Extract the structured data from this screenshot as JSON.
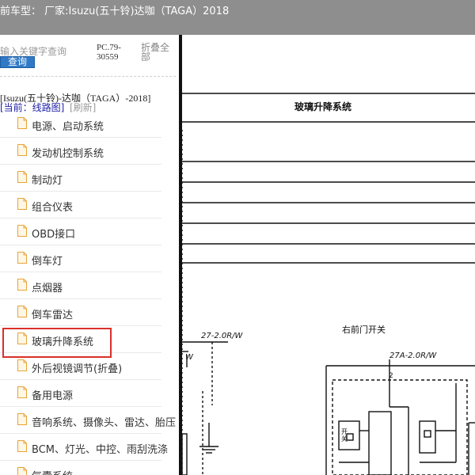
{
  "header": {
    "title": "前车型： 厂家:Isuzu(五十铃)达咖（TAGA）2018"
  },
  "sidebar": {
    "search_placeholder": "输入关键字查询",
    "search_button_label": "查询",
    "code_text": "PC.79-30559",
    "collapse_label": "折叠全部",
    "vehicle_title": "[Isuzu(五十铃)-达咖（TAGA）-2018]",
    "current_label": "[当前：线路图]",
    "refresh_label": "[刷新]",
    "items": [
      {
        "label": "电源、启动系统"
      },
      {
        "label": "发动机控制系统"
      },
      {
        "label": "制动灯"
      },
      {
        "label": "组合仪表"
      },
      {
        "label": "OBD接口"
      },
      {
        "label": "倒车灯"
      },
      {
        "label": "点烟器"
      },
      {
        "label": "倒车雷达"
      },
      {
        "label": "玻璃升降系统"
      },
      {
        "label": "外后视镜调节(折叠)"
      },
      {
        "label": "备用电源"
      },
      {
        "label": "音响系统、摄像头、雷达、胎压"
      },
      {
        "label": "BCM、灯光、中控、雨刮洗涤"
      },
      {
        "label": "气囊系统"
      }
    ],
    "highlight_color": "#d9302a"
  },
  "diagram": {
    "title": "玻璃升降系统",
    "switch_label": "右前门开关",
    "wire_left": "27-2.0R/W",
    "wire_mid": "27A-2.0R/W",
    "wire_w": "W",
    "pin_2": "2",
    "sw_text": "开关"
  }
}
